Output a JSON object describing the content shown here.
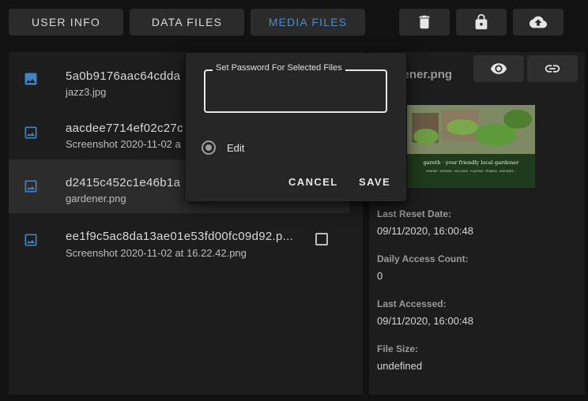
{
  "tabs": [
    {
      "label": "USER INFO",
      "active": false
    },
    {
      "label": "DATA FILES",
      "active": false
    },
    {
      "label": "MEDIA FILES",
      "active": true
    }
  ],
  "toolbar": {
    "icons": [
      "trash-icon",
      "lock-icon",
      "cloud-upload-icon"
    ]
  },
  "files": [
    {
      "id": "5a0b9176aac64cdda",
      "name": "jazz3.jpg",
      "selected": false
    },
    {
      "id": "aacdee7714ef02c27c",
      "name": "Screenshot 2020-11-02 a",
      "selected": false
    },
    {
      "id": "d2415c452c1e46b1a",
      "name": "gardener.png",
      "selected": true
    },
    {
      "id": "ee1f9c5ac8da13ae01e53fd00fc09d92.p...",
      "name": "Screenshot 2020-11-02 at 16.22.42.png",
      "selected": false
    }
  ],
  "details": {
    "title": "gardener.png",
    "thumbnail_text": "gareth · your friendly local gardener",
    "thumbnail_sub": "MOWING · WEEDING · MULCHING · PLANTING · PRUNING · AND MORE...",
    "fields": [
      {
        "label": "Last Reset Date:",
        "value": "09/11/2020, 16:00:48"
      },
      {
        "label": "Daily Access Count:",
        "value": "0"
      },
      {
        "label": "Last Accessed:",
        "value": "09/11/2020, 16:00:48"
      },
      {
        "label": "File Size:",
        "value": "undefined"
      }
    ]
  },
  "dialog": {
    "password_label": "Set Password For Selected Files",
    "password_value": "",
    "radio_label": "Edit",
    "cancel_label": "CANCEL",
    "save_label": "SAVE"
  },
  "colors": {
    "accent": "#4a8ccc",
    "background": "#121212",
    "panel": "#1d1d1d",
    "dialog": "#262626"
  }
}
